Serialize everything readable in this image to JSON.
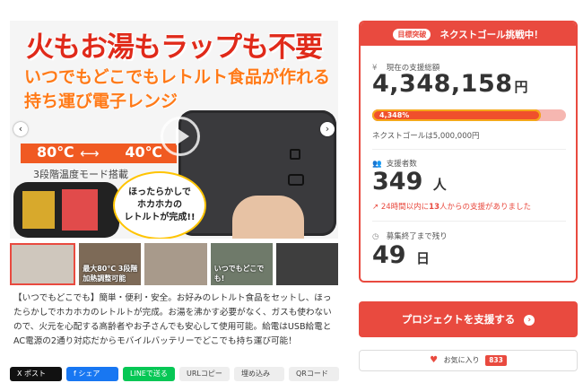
{
  "hero": {
    "title": "火もお湯もラップも不要",
    "line2": "いつでもどこでもレトルト食品が作れる",
    "line3": "持ち運び電子レンジ",
    "temp_left": "80℃",
    "temp_right": "40℃",
    "temp_arrow": "⟷",
    "temp_caption": "3段階温度モード搭載",
    "speech": [
      "ほったらかしで",
      "ホカホカの",
      "レトルトが完成!!"
    ]
  },
  "thumbnails": [
    {
      "label": ""
    },
    {
      "label": "最大80℃ 3段階加熱調整可能"
    },
    {
      "label": ""
    },
    {
      "label": "いつでもどこでも!"
    },
    {
      "label": ""
    }
  ],
  "description": "【いつでもどこでも】簡単・便利・安全。お好みのレトルト食品をセットし、ほったらかしでホカホカのレトルトが完成。お湯を沸かす必要がなく、ガスも使わないので、火元を心配する高齢者やお子さんでも安心して使用可能。給電はUSB給電とAC電源の2通り対応だからモバイルバッテリーでどこでも持ち運び可能！",
  "share": {
    "x": "X ポスト",
    "facebook": "f シェア",
    "line": "LINEで送る",
    "url": "URLコピー",
    "embed": "埋め込み",
    "qr": "QRコード"
  },
  "panel": {
    "badge": "目標突破",
    "header": "ネクストゴール挑戦中！",
    "amount_label": "現在の支援総額",
    "amount": "4,348,158",
    "amount_unit": "円",
    "progress_text": "4,348%",
    "progress_fill_ratio": 0.87,
    "goal_text": "ネクストゴールは5,000,000円",
    "backers_label": "支援者数",
    "backers": "349",
    "backers_unit": "人",
    "trend_prefix": "24時間以内に",
    "trend_count": "13",
    "trend_suffix": "人からの支援がありました",
    "days_label": "募集終了まで残り",
    "days": "49",
    "days_unit": "日"
  },
  "actions": {
    "support_label": "プロジェクトを支援する",
    "favorite_label": "お気に入り",
    "favorite_count": "833"
  },
  "colors": {
    "accent": "#e94a3f",
    "line_green": "#06c755",
    "facebook_blue": "#1877f2"
  }
}
